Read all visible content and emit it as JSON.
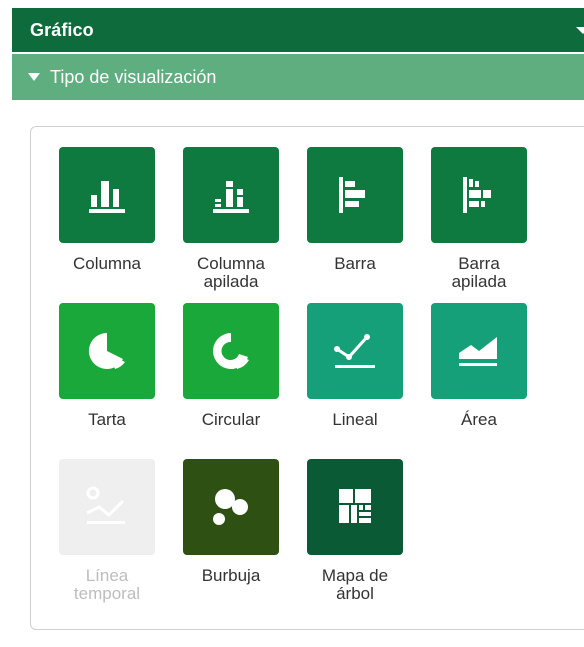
{
  "header": {
    "title": "Gráfico"
  },
  "section": {
    "title": "Tipo de visualización"
  },
  "options": [
    {
      "line1": "Columna",
      "line2": "",
      "color": "#0e7a3f",
      "icon": "column-chart-icon"
    },
    {
      "line1": "Columna",
      "line2": "apilada",
      "color": "#0e7a3f",
      "icon": "stacked-column-chart-icon"
    },
    {
      "line1": "Barra",
      "line2": "",
      "color": "#0e7a3f",
      "icon": "bar-chart-icon"
    },
    {
      "line1": "Barra",
      "line2": "apilada",
      "color": "#0e7a3f",
      "icon": "stacked-bar-chart-icon"
    },
    {
      "line1": "Tarta",
      "line2": "",
      "color": "#1ba83a",
      "icon": "pie-chart-icon"
    },
    {
      "line1": "Circular",
      "line2": "",
      "color": "#1ba83a",
      "icon": "donut-chart-icon"
    },
    {
      "line1": "Lineal",
      "line2": "",
      "color": "#16a07a",
      "icon": "line-chart-icon"
    },
    {
      "line1": "Área",
      "line2": "",
      "color": "#16a07a",
      "icon": "area-chart-icon"
    },
    {
      "line1": "Línea",
      "line2": "temporal",
      "color": "#efefef",
      "icon": "time-series-chart-icon",
      "disabled": true
    },
    {
      "line1": "Burbuja",
      "line2": "",
      "color": "#2f5013",
      "icon": "bubble-chart-icon"
    },
    {
      "line1": "Mapa de",
      "line2": "árbol",
      "color": "#0a5a35",
      "icon": "treemap-chart-icon"
    }
  ]
}
